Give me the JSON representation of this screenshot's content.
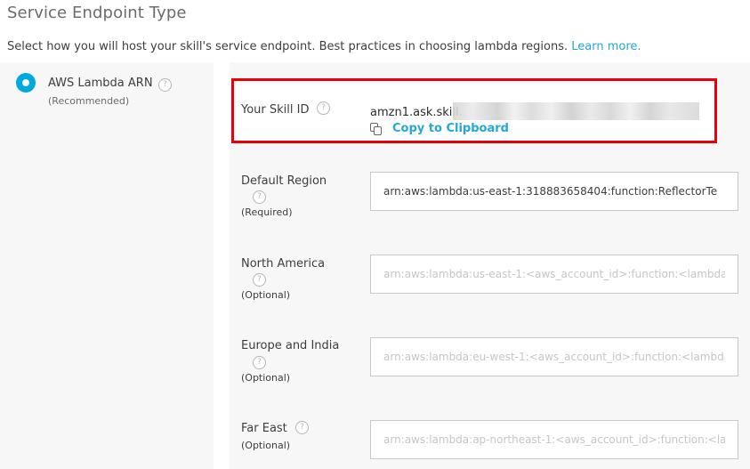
{
  "header": {
    "title": "Service Endpoint Type",
    "description": "Select how you will host your skill's service endpoint. Best practices in choosing lambda regions. ",
    "learn_more": "Learn more."
  },
  "option": {
    "label": "AWS Lambda ARN",
    "sublabel": "(Recommended)",
    "selected": true
  },
  "skill_id": {
    "label": "Your Skill ID",
    "value": "amzn1.ask.skill.",
    "copy_label": "Copy to Clipboard"
  },
  "fields": {
    "default_region": {
      "label": "Default Region",
      "sublabel": "(Required)",
      "value": "arn:aws:lambda:us-east-1:318883658404:function:ReflectorTe"
    },
    "north_america": {
      "label": "North America",
      "sublabel": "(Optional)",
      "placeholder": "arn:aws:lambda:us-east-1:<aws_account_id>:function:<lambda"
    },
    "europe_india": {
      "label": "Europe and India",
      "sublabel": "(Optional)",
      "placeholder": "arn:aws:lambda:eu-west-1:<aws_account_id>:function:<lambda"
    },
    "far_east": {
      "label": "Far East",
      "sublabel": "(Optional)",
      "placeholder": "arn:aws:lambda:ap-northeast-1:<aws_account_id>:function:<la"
    }
  },
  "help_glyph": "?",
  "colors": {
    "accent": "#00a8e1",
    "link": "#23a8d8",
    "highlight": "#e8000b"
  }
}
